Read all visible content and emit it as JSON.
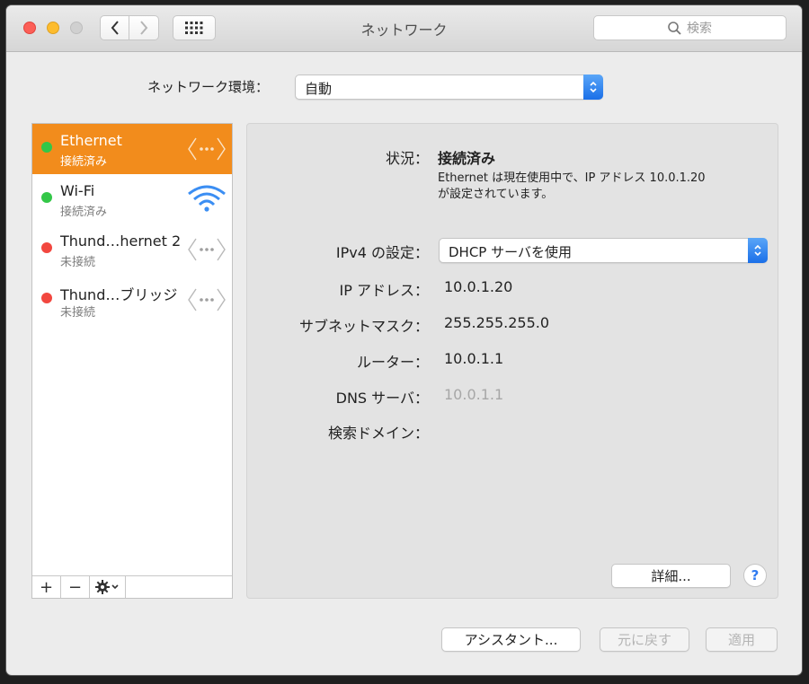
{
  "window": {
    "title": "ネットワーク"
  },
  "toolbar": {
    "search_placeholder": "検索"
  },
  "location": {
    "label": "ネットワーク環境：",
    "value": "自動"
  },
  "services": [
    {
      "name": "Ethernet",
      "status": "接続済み",
      "status_color": "#33c748",
      "selected": true,
      "icon": "ethernet-icon"
    },
    {
      "name": "Wi-Fi",
      "status": "接続済み",
      "status_color": "#33c748",
      "selected": false,
      "icon": "wifi-icon"
    },
    {
      "name": "Thund…hernet 2",
      "status": "未接続",
      "status_color": "#f2473f",
      "selected": false,
      "icon": "ethernet-icon"
    },
    {
      "name": "Thund…ブリッジ",
      "status": "未接続",
      "status_color": "#f2473f",
      "selected": false,
      "icon": "ethernet-icon"
    }
  ],
  "sidebar_actions": {
    "add": "+",
    "remove": "−"
  },
  "detail": {
    "status_label": "状況：",
    "status_value": "接続済み",
    "status_desc_1": "Ethernet は現在使用中で、IP アドレス 10.0.1.20",
    "status_desc_2": "が設定されています。",
    "ipv4_label": "IPv4 の設定：",
    "ipv4_value": "DHCP サーバを使用",
    "ip_label": "IP アドレス：",
    "ip_value": "10.0.1.20",
    "subnet_label": "サブネットマスク：",
    "subnet_value": "255.255.255.0",
    "router_label": "ルーター：",
    "router_value": "10.0.1.1",
    "dns_label": "DNS サーバ：",
    "dns_value": "10.0.1.1",
    "search_domain_label": "検索ドメイン：",
    "advanced_button": "詳細...",
    "help_button": "?"
  },
  "footer": {
    "assistant": "アシスタント...",
    "revert": "元に戻す",
    "apply": "適用"
  },
  "colors": {
    "accent": "#f28c1c",
    "connected": "#33c748",
    "disconnected": "#f2473f",
    "help": "#2f7bf1"
  }
}
